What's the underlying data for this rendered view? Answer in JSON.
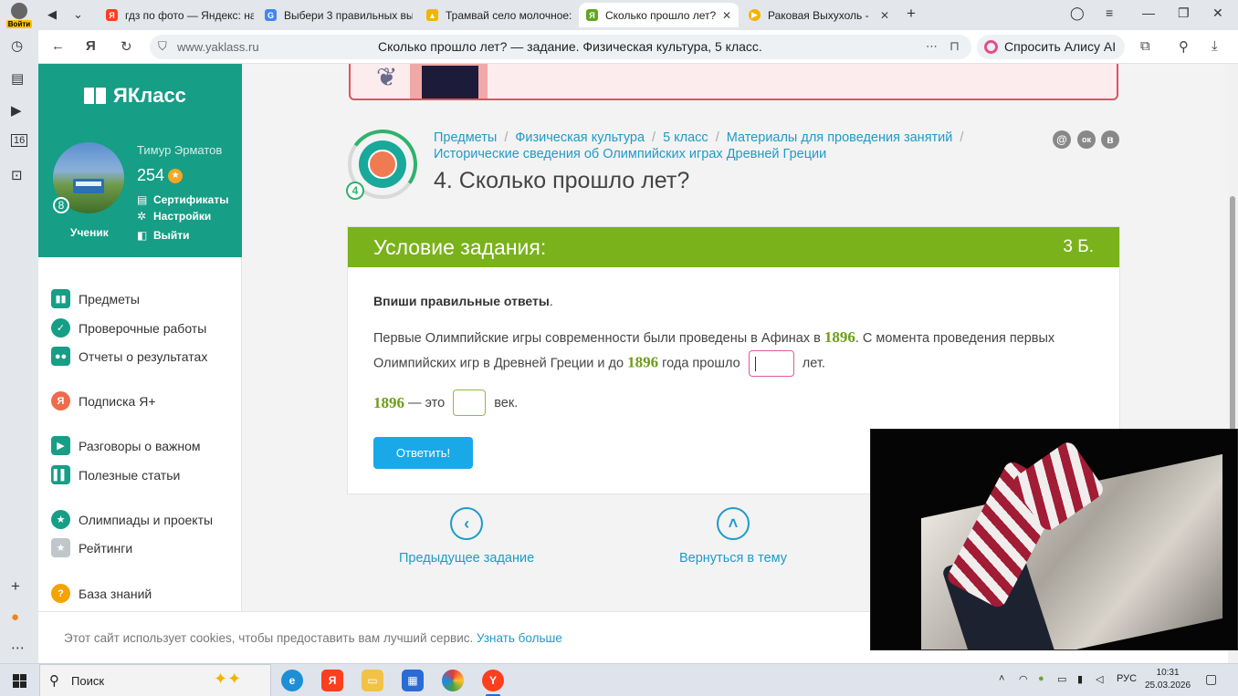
{
  "browser": {
    "profile_label": "Войти",
    "tabs": [
      {
        "title": "гдз по фото — Яндекс: на",
        "fav_color": "#fc3f1d",
        "fav": "Я"
      },
      {
        "title": "Выбери 3 правильных вы",
        "fav_color": "#4285f4",
        "fav": "G"
      },
      {
        "title": "Трамвай село молочное:",
        "fav_color": "#f2b400",
        "fav": "▲"
      },
      {
        "title": "Сколько прошло лет?",
        "fav_color": "#5fa71d",
        "fav": "Я"
      },
      {
        "title": "Раковая Выхухоль -",
        "fav_color": "#f2b400",
        "fav": "▶"
      }
    ],
    "url_host": "www.yaklass.ru",
    "page_title": "Сколько прошло лет? — задание. Физическая культура, 5 класс.",
    "alice_label": "Спросить Алису AI",
    "side_badge": "16"
  },
  "sidebar": {
    "logo": "ЯКласс",
    "user_name": "Тимур Эрматов",
    "points": "254",
    "level": "8",
    "role": "Ученик",
    "links": [
      "Сертификаты",
      "Настройки",
      "Выйти"
    ],
    "menu": [
      {
        "label": "Предметы",
        "color": "#169e86",
        "icon": "▮▮"
      },
      {
        "label": "Проверочные работы",
        "color": "#169e86",
        "icon": "✓"
      },
      {
        "label": "Отчеты о результатах",
        "color": "#169e86",
        "icon": "●●"
      },
      {
        "label": "Подписка Я+",
        "color": "#ef6b4b",
        "icon": "Я"
      },
      {
        "label": "Разговоры о важном",
        "color": "#169e86",
        "icon": "▶"
      },
      {
        "label": "Полезные статьи",
        "color": "#169e86",
        "icon": "▌▌"
      },
      {
        "label": "Олимпиады и проекты",
        "color": "#169e86",
        "icon": "★"
      },
      {
        "label": "Рейтинги",
        "color": "#bfc6cc",
        "icon": "★"
      },
      {
        "label": "База знаний",
        "color": "#f4a300",
        "icon": "?"
      }
    ]
  },
  "breadcrumbs": [
    "Предметы",
    "Физическая культура",
    "5 класс",
    "Материалы для проведения занятий",
    "Исторические сведения об Олимпийских играх Древней Греции"
  ],
  "share_icons": [
    "@",
    "ок",
    "в"
  ],
  "topic_number": "4",
  "task_title": "4. Сколько прошло лет?",
  "card": {
    "header": "Условие задания:",
    "points": "3 Б.",
    "instruction": "Впиши правильные ответы",
    "instruction_end": ".",
    "q1_a": "Первые Олимпийские игры современности были проведены в Афинах в ",
    "year": "1896",
    "q1_b": ". С момента проведения первых Олимпийских игр в Древней Греции и до ",
    "q1_c": " года прошло ",
    "q1_d": " лет.",
    "q2_a": " — это ",
    "q2_b": " век.",
    "submit": "Ответить!"
  },
  "nav": {
    "prev": "Предыдущее задание",
    "back": "Вернуться в тему"
  },
  "cookie": {
    "text": "Этот сайт использует cookies, чтобы предоставить вам лучший сервис. ",
    "link": "Узнать больше"
  },
  "taskbar": {
    "search_label": "Поиск",
    "lang": "РУС",
    "time": "10:31",
    "date": "25.03.2026"
  }
}
